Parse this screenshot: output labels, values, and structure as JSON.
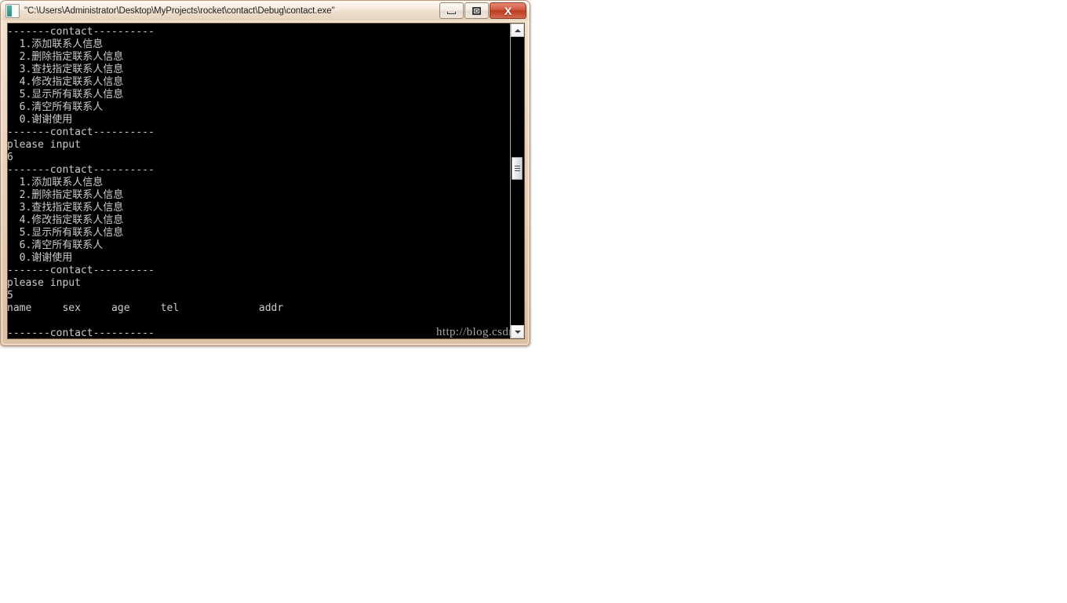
{
  "window": {
    "title": "\"C:\\Users\\Administrator\\Desktop\\MyProjects\\rocket\\contact\\Debug\\contact.exe\"",
    "icon": "console-app-icon",
    "buttons": {
      "minimize_label": "–",
      "maximize_label": "□",
      "close_label": "X"
    },
    "frame_color": "#e9d2bc",
    "titlebar_text_color": "#1c1c1c",
    "close_button_color": "#b93b22"
  },
  "console": {
    "background_color": "#000000",
    "text_color": "#cccccc",
    "font_size_px": 13,
    "lines": [
      "-------contact----------",
      "  1.添加联系人信息",
      "  2.删除指定联系人信息",
      "  3.查找指定联系人信息",
      "  4.修改指定联系人信息",
      "  5.显示所有联系人信息",
      "  6.清空所有联系人",
      "  0.谢谢使用",
      "-------contact----------",
      "please input",
      "6",
      "-------contact----------",
      "  1.添加联系人信息",
      "  2.删除指定联系人信息",
      "  3.查找指定联系人信息",
      "  4.修改指定联系人信息",
      "  5.显示所有联系人信息",
      "  6.清空所有联系人",
      "  0.谢谢使用",
      "-------contact----------",
      "please input",
      "5",
      "name     sex     age     tel             addr",
      "",
      "-------contact----------"
    ],
    "menu_items": [
      {
        "key": "1",
        "label": "添加联系人信息"
      },
      {
        "key": "2",
        "label": "删除指定联系人信息"
      },
      {
        "key": "3",
        "label": "查找指定联系人信息"
      },
      {
        "key": "4",
        "label": "修改指定联系人信息"
      },
      {
        "key": "5",
        "label": "显示所有联系人信息"
      },
      {
        "key": "6",
        "label": "清空所有联系人"
      },
      {
        "key": "0",
        "label": "谢谢使用"
      }
    ],
    "header_banner": "-------contact----------",
    "prompt": "please input",
    "entered_values": [
      "6",
      "5"
    ],
    "table_headers": [
      "name",
      "sex",
      "age",
      "tel",
      "addr"
    ]
  },
  "watermark": {
    "text": "http://blog.csdn.net/ret_skd",
    "color": "#b9b2ac"
  },
  "scrollbar": {
    "up_arrow": "scroll-up-arrow",
    "down_arrow": "scroll-down-arrow",
    "thumb": "scroll-thumb"
  }
}
